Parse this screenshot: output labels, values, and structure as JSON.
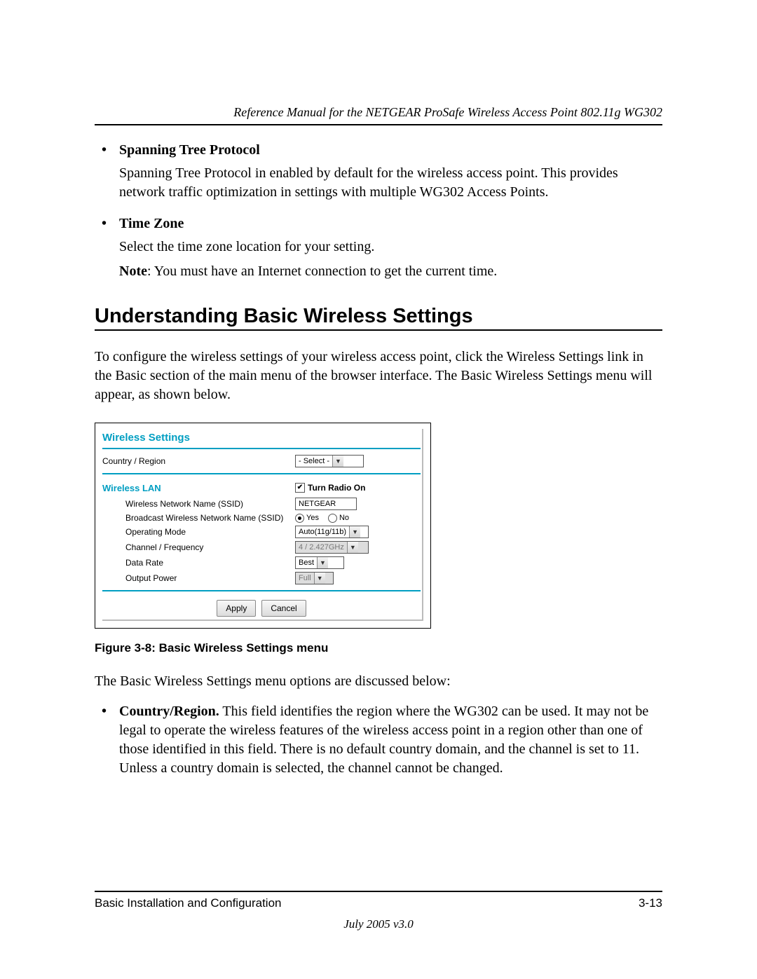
{
  "header": {
    "title": "Reference Manual for the NETGEAR ProSafe Wireless Access Point 802.11g WG302"
  },
  "bullets": {
    "spanning": {
      "title": "Spanning Tree Protocol",
      "body": "Spanning Tree Protocol in enabled by default for the wireless access point. This provides network traffic optimization in settings with multiple WG302 Access Points."
    },
    "timezone": {
      "title": "Time Zone",
      "body": "Select the time zone location for your setting.",
      "note_label": "Note",
      "note_body": ": You must have an Internet connection to get the current time."
    }
  },
  "section_heading": "Understanding Basic Wireless Settings",
  "intro": "To configure the wireless settings of your wireless access point, click the Wireless Settings link in the Basic section of the main menu of the browser interface. The Basic Wireless Settings menu will appear, as shown below.",
  "panel": {
    "title": "Wireless Settings",
    "country_label": "Country / Region",
    "country_value": "- Select -",
    "wlan_title": "Wireless LAN",
    "turn_radio": "Turn Radio On",
    "ssid_label": "Wireless Network Name (SSID)",
    "ssid_value": "NETGEAR",
    "broadcast_label": "Broadcast Wireless Network Name (SSID)",
    "yes": "Yes",
    "no": "No",
    "opmode_label": "Operating Mode",
    "opmode_value": "Auto(11g/11b)",
    "channel_label": "Channel / Frequency",
    "channel_value": "4 / 2.427GHz",
    "datarate_label": "Data Rate",
    "datarate_value": "Best",
    "power_label": "Output Power",
    "power_value": "Full",
    "apply": "Apply",
    "cancel": "Cancel"
  },
  "figure_caption": "Figure 3-8: Basic Wireless Settings menu",
  "discussed": "The Basic Wireless Settings menu options are discussed below:",
  "country_bullet": {
    "lead": "Country/Region.",
    "body": " This field identifies the region where the WG302 can be used. It may not be legal to operate the wireless features of the wireless access point in a region other than one of those identified in this field. There is no default country domain, and the channel is set to 11. Unless a country domain is selected, the channel cannot be changed."
  },
  "footer": {
    "left": "Basic Installation and Configuration",
    "right": "3-13",
    "date": "July 2005 v3.0"
  }
}
